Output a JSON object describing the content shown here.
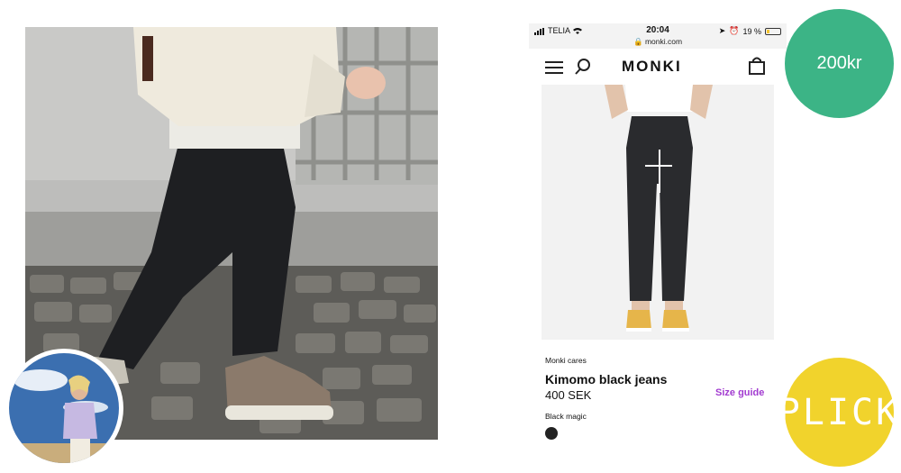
{
  "left_photo": {
    "alt": "street-style-photo"
  },
  "avatar": {
    "alt": "user-avatar"
  },
  "phone": {
    "status_bar": {
      "carrier": "TELIA",
      "time": "20:04",
      "url": "monki.com",
      "battery": "19 %"
    },
    "nav": {
      "brand": "MONKI",
      "menu_icon": "menu-icon",
      "search_icon": "search-icon",
      "bag_icon": "shopping-bag-icon"
    },
    "product": {
      "collection": "Monki cares",
      "name": "Kimomo black jeans",
      "price": "400 SEK",
      "size_guide": "Size guide",
      "color_name": "Black magic",
      "swatch_color": "#222222"
    }
  },
  "badges": {
    "price": "200kr",
    "price_color": "#3cb486",
    "brand": "PLICK",
    "brand_color": "#f1d32c"
  }
}
